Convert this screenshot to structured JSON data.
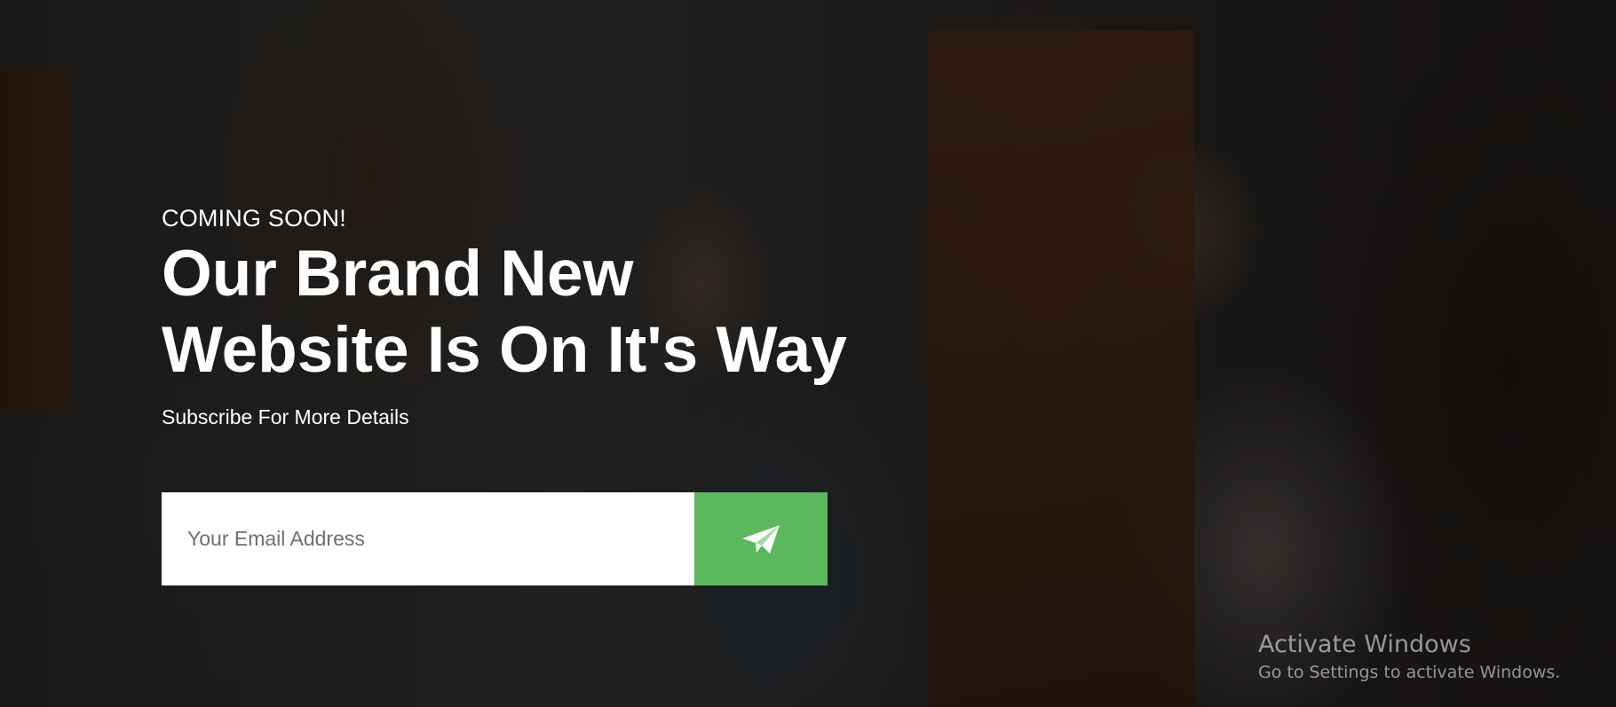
{
  "hero": {
    "eyebrow": "COMING SOON!",
    "headline_line1": "Our Brand New",
    "headline_line2": "Website Is On It's Way",
    "subtitle": "Subscribe For More Details"
  },
  "subscribe_form": {
    "email_placeholder": "Your Email Address",
    "email_value": "",
    "submit_icon": "paper-plane-icon",
    "accent_color": "#5cb85c"
  },
  "system_watermark": {
    "title": "Activate Windows",
    "subtitle": "Go to Settings to activate Windows."
  }
}
